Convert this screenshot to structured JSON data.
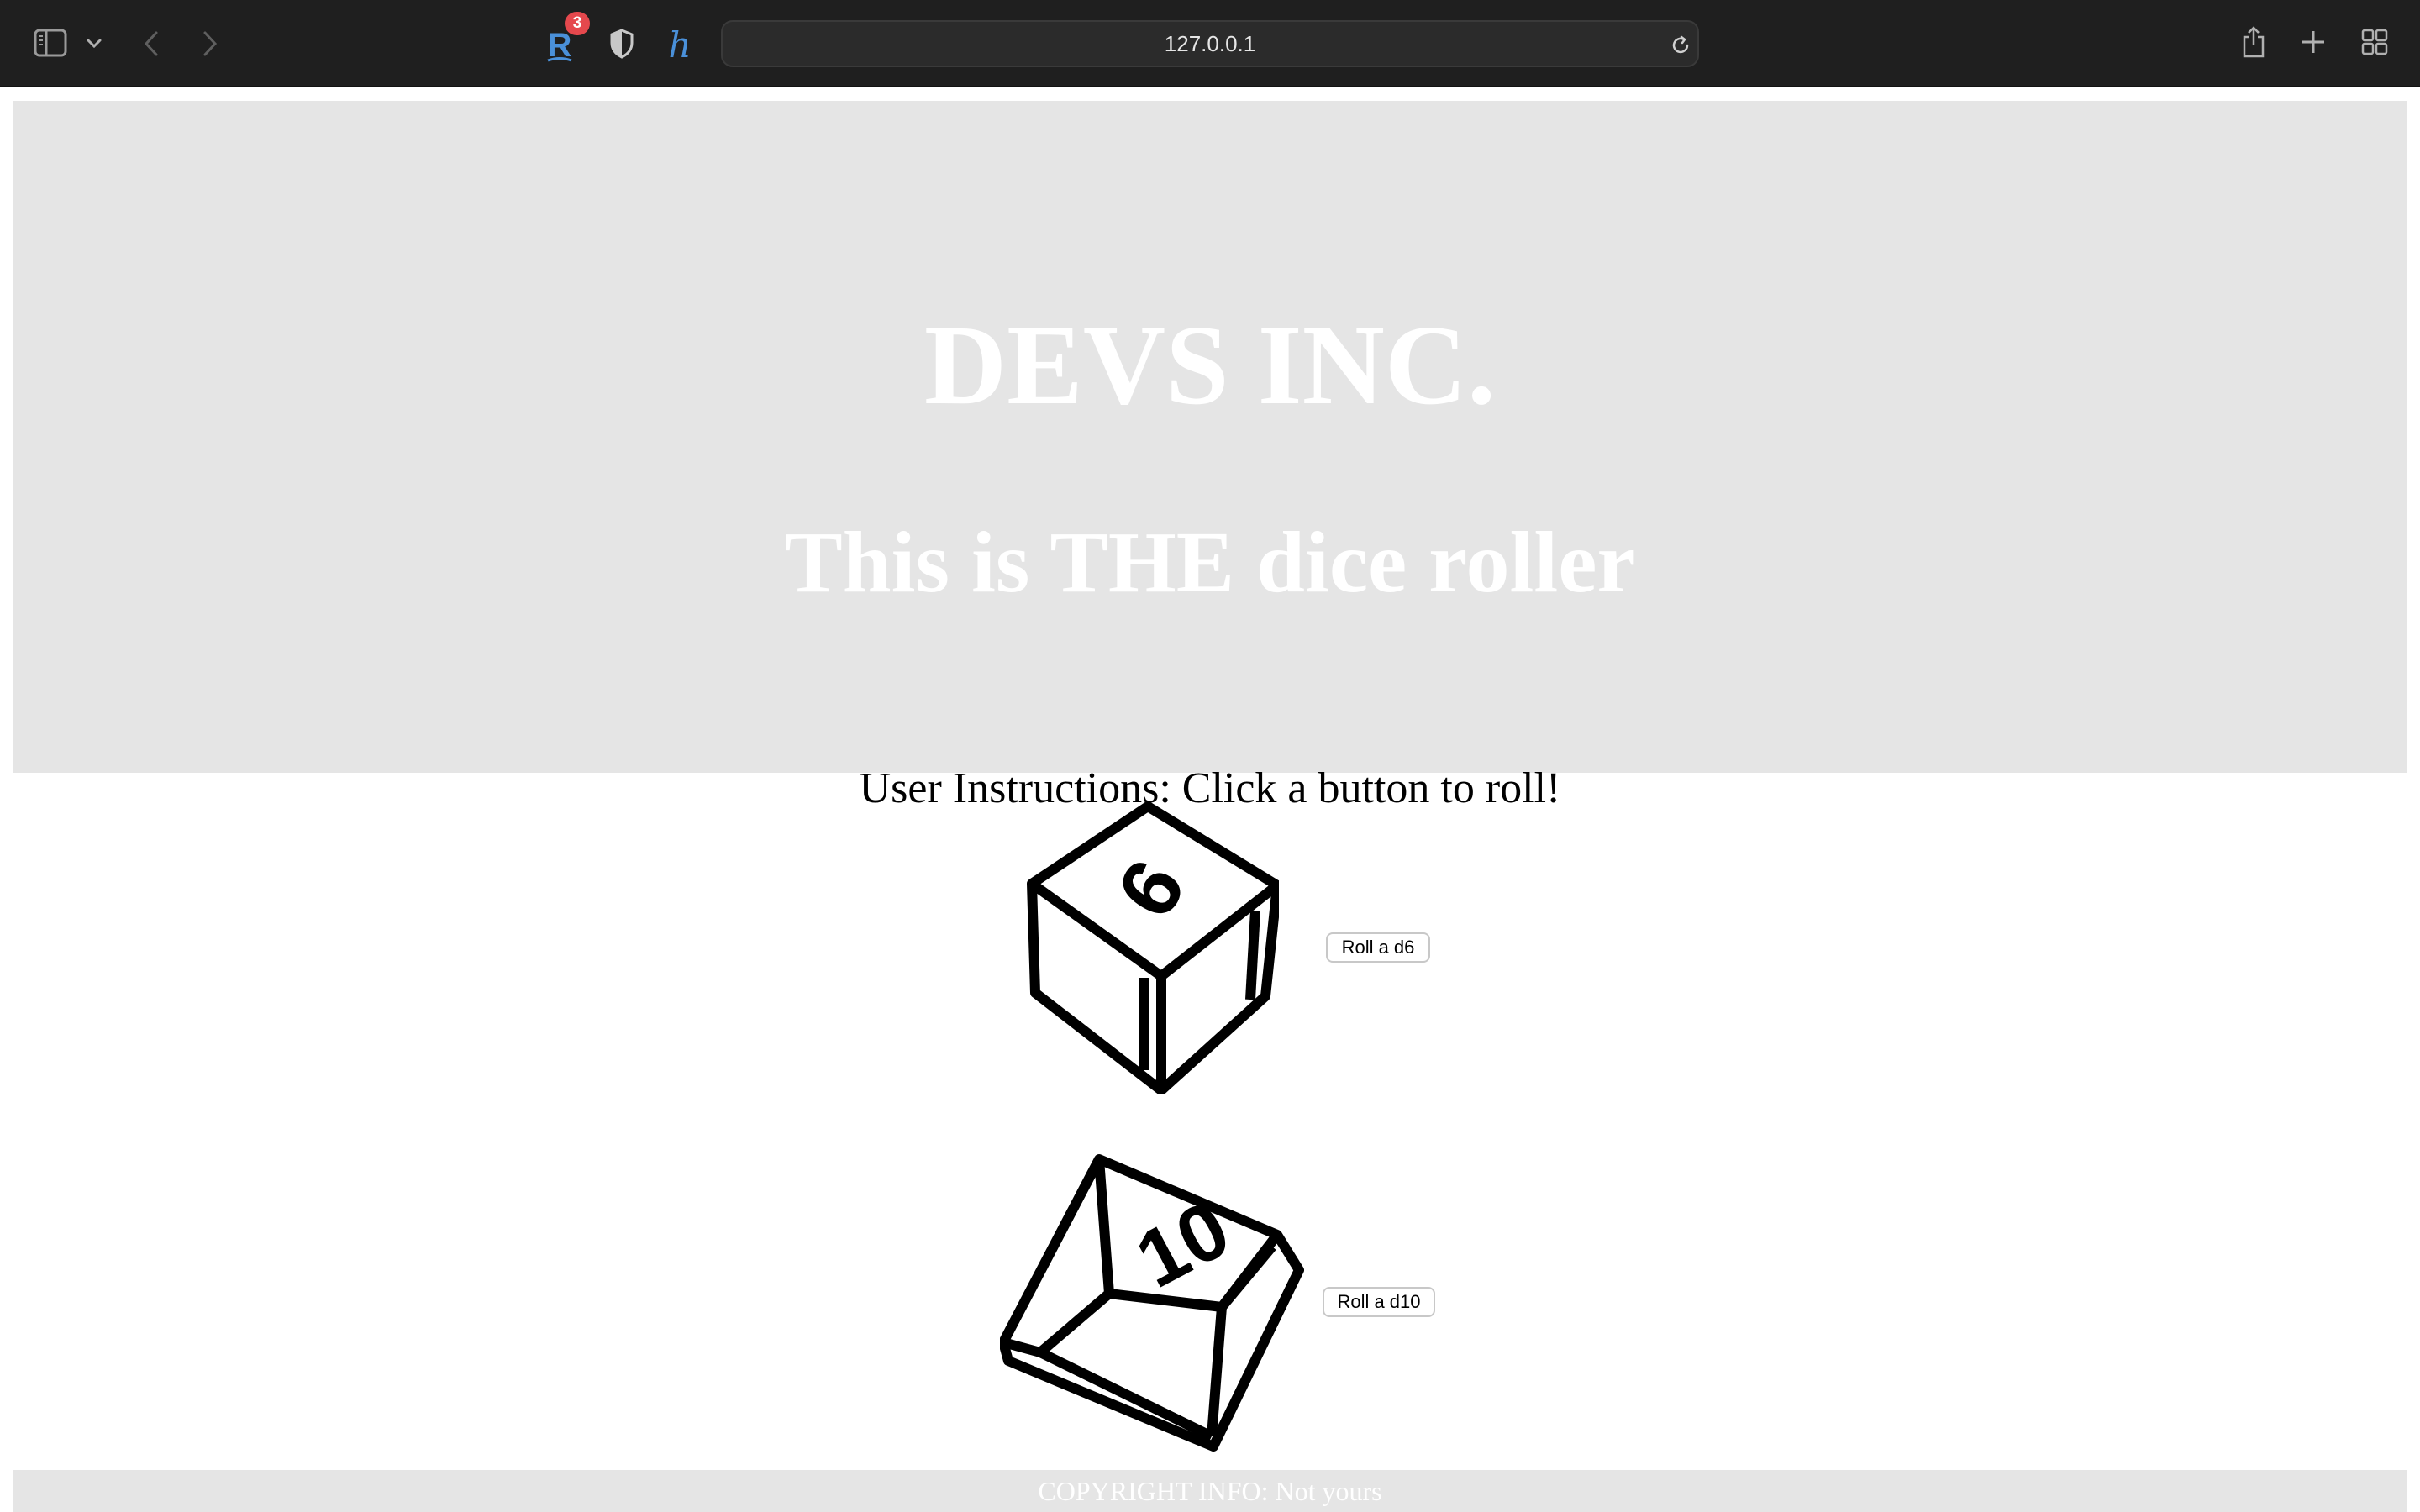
{
  "browser": {
    "url": "127.0.0.1",
    "extension_badge_count": "3",
    "icons": [
      "sidebar-icon",
      "chevron-down-icon",
      "back-icon",
      "forward-icon",
      "readwise-extension-icon",
      "privacy-shield-icon",
      "honey-extension-icon",
      "reload-icon",
      "share-icon",
      "new-tab-icon",
      "tab-overview-icon"
    ],
    "colors": {
      "toolbar": "#1f1f1f",
      "address_bar": "#2b2b2b",
      "extension_blue": "#4a90d9",
      "badge_red": "#e5484d"
    }
  },
  "page": {
    "company_name": "DEVS INC.",
    "subtitle": "This is THE dice roller",
    "instructions": "User Instructions: Click a button to roll!",
    "dice": [
      {
        "face_label": "6",
        "button_label": "Roll a d6",
        "icon": "d6-die-icon"
      },
      {
        "face_label": "10",
        "button_label": "Roll a d10",
        "icon": "d10-die-icon"
      }
    ],
    "footer": "COPYRIGHT INFO: Not yours",
    "colors": {
      "header_bg": "#e5e5e5",
      "heading_text": "#ffffff",
      "body_text": "#000000"
    }
  }
}
